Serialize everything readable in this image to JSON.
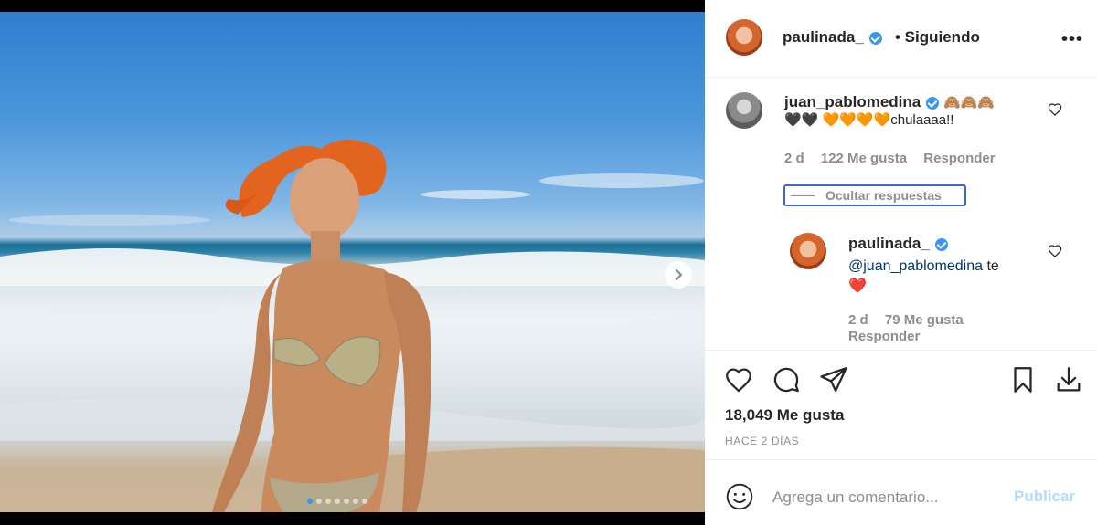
{
  "post": {
    "author": "paulinada_",
    "follow_status": "• Siguiendo",
    "more_icon": "more-options-icon",
    "carousel_total": 7,
    "carousel_active": 1
  },
  "comments": [
    {
      "user": "juan_pablomedina",
      "emoji_line1": "🙈🙈🙈",
      "text": "🖤🖤 🧡🧡🧡🧡chulaaaa!!",
      "time": "2 d",
      "likes": "122 Me gusta",
      "reply_label": "Responder",
      "hide_replies_label": "Ocultar respuestas"
    }
  ],
  "reply": {
    "user": "paulinada_",
    "mention": "@juan_pablomedina",
    "text_after": " te",
    "emoji": "❤️",
    "time": "2 d",
    "likes": "79 Me gusta",
    "reply_label": "Responder"
  },
  "actions": {
    "likes": "18,049 Me gusta",
    "posted_ago": "HACE 2 DÍAS"
  },
  "composer": {
    "placeholder": "Agrega un comentario...",
    "publish_label": "Publicar"
  },
  "colors": {
    "accent": "#3897f0",
    "publish_disabled": "#b3dbff",
    "secondary_text": "#8e8e8e"
  }
}
